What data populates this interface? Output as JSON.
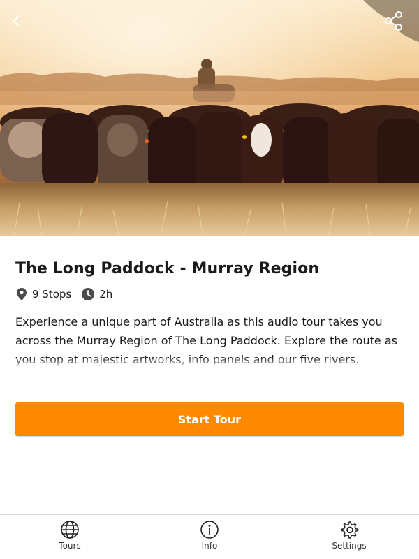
{
  "hero": {
    "alt": "Cattle herd being mustered at sunset",
    "colors": {
      "sky": "#f4d9a8",
      "dust": "#d99a55",
      "ground": "#b58a4a"
    }
  },
  "header": {
    "back_icon": "chevron-left-icon",
    "share_icon": "share-icon"
  },
  "tour": {
    "title": "The Long Paddock - Murray Region",
    "stops": "9 Stops",
    "duration": "2h",
    "description": "Experience a unique part of Australia as this audio tour takes you across the Murray Region of The Long Paddock. Explore the route as you stop at majestic artworks, info panels and our five rivers."
  },
  "actions": {
    "start_label": "Start Tour",
    "accent": "#ff8a00"
  },
  "nav": {
    "items": [
      {
        "label": "Tours",
        "icon": "globe-icon"
      },
      {
        "label": "Info",
        "icon": "info-icon"
      },
      {
        "label": "Settings",
        "icon": "gear-icon"
      }
    ]
  }
}
